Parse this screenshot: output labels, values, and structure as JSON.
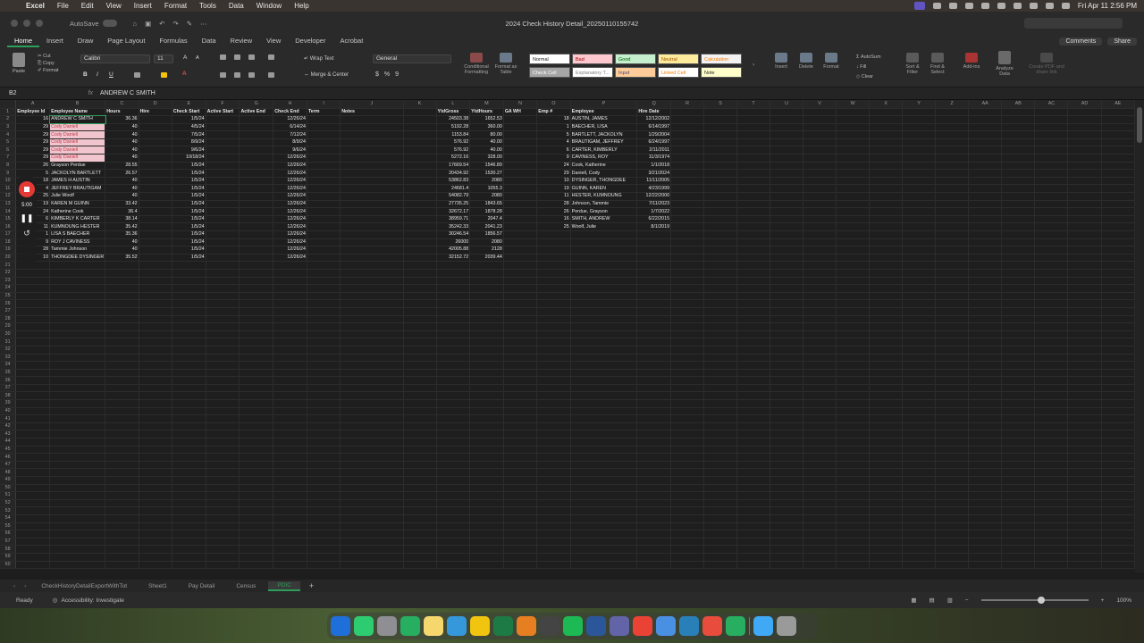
{
  "menubar": {
    "app": "Excel",
    "menus": [
      "File",
      "Edit",
      "View",
      "Insert",
      "Format",
      "Tools",
      "Data",
      "Window",
      "Help"
    ],
    "clock": "Fri Apr 11  2:56 PM"
  },
  "titlebar": {
    "autosave": "AutoSave",
    "doc_title": "2024 Check History Detail_20250110155742"
  },
  "ribbon_tabs": [
    "Home",
    "Insert",
    "Draw",
    "Page Layout",
    "Formulas",
    "Data",
    "Review",
    "View",
    "Developer",
    "Acrobat"
  ],
  "ribbon_buttons": {
    "comments": "Comments",
    "share": "Share"
  },
  "ribbon": {
    "paste": "Paste",
    "cut": "Cut",
    "copy": "Copy",
    "format": "Format",
    "font_name": "Calibri",
    "font_size": "11",
    "wrap_text": "Wrap Text",
    "merge_center": "Merge & Center",
    "number_format": "General",
    "cond_format": "Conditional Formatting",
    "format_table": "Format as Table",
    "styles": [
      {
        "label": "Normal",
        "bg": "#ffffff",
        "fg": "#222222"
      },
      {
        "label": "Bad",
        "bg": "#ffc7ce",
        "fg": "#9c0006"
      },
      {
        "label": "Good",
        "bg": "#c6efce",
        "fg": "#006100"
      },
      {
        "label": "Neutral",
        "bg": "#ffeb9c",
        "fg": "#9c5700"
      },
      {
        "label": "Calculation",
        "bg": "#f2f2f2",
        "fg": "#fa7d00"
      },
      {
        "label": "Check Cell",
        "bg": "#a5a5a5",
        "fg": "#ffffff"
      },
      {
        "label": "Explanatory T...",
        "bg": "#ffffff",
        "fg": "#7f7f7f"
      },
      {
        "label": "Input",
        "bg": "#ffcc99",
        "fg": "#3f3f76"
      },
      {
        "label": "Linked Cell",
        "bg": "#ffffff",
        "fg": "#fa7d00"
      },
      {
        "label": "Note",
        "bg": "#ffffcc",
        "fg": "#222222"
      }
    ],
    "insert": "Insert",
    "delete": "Delete",
    "format_cells": "Format",
    "autosum": "AutoSum",
    "fill": "Fill",
    "clear": "Clear",
    "sort_filter": "Sort & Filter",
    "find_select": "Find & Select",
    "addins": "Add-ins",
    "analyze": "Analyze Data",
    "create_pdf": "Create PDF and share link"
  },
  "formula_bar": {
    "cell_ref": "B2",
    "fx": "fx",
    "content": "ANDREW C SMITH"
  },
  "grid": {
    "columns": [
      "A",
      "B",
      "C",
      "D",
      "E",
      "F",
      "G",
      "H",
      "I",
      "J",
      "K",
      "L",
      "M",
      "N",
      "O",
      "P",
      "Q",
      "R",
      "S",
      "T",
      "U",
      "V",
      "W",
      "X",
      "Y",
      "Z",
      "AA",
      "AB",
      "AC",
      "AD",
      "AE"
    ],
    "rows": [
      [
        "Employee Id",
        "Employee Name",
        "Hours",
        "Hire",
        "Check Start",
        "Active Start",
        "Active End",
        "Check End",
        "Term",
        "Notes",
        "",
        "YtdGross",
        "YtdHours",
        "GA WH",
        "Emp #",
        "Employee",
        "Hire Date"
      ],
      [
        "16",
        "ANDREW C SMITH",
        "36.36",
        "",
        "1/5/24",
        "",
        "",
        "12/26/24",
        "",
        "",
        "",
        "24503.38",
        "1652.53",
        "",
        "18",
        "AUSTIN, JAMES",
        "12/12/2002"
      ],
      [
        "29",
        "Cody Daniell",
        "40",
        "",
        "4/5/24",
        "",
        "",
        "6/14/24",
        "",
        "",
        "",
        "5192.28",
        "360.00",
        "",
        "1",
        "BAECHER, LISA",
        "6/14/1997"
      ],
      [
        "29",
        "Cody Daniell",
        "40",
        "",
        "7/5/24",
        "",
        "",
        "7/12/24",
        "",
        "",
        "",
        "1153.84",
        "80.00",
        "",
        "5",
        "BARTLETT, JACKOLYN",
        "1/29/2004"
      ],
      [
        "29",
        "Cody Daniell",
        "40",
        "",
        "8/9/24",
        "",
        "",
        "8/9/24",
        "",
        "",
        "",
        "576.92",
        "40.00",
        "",
        "4",
        "BRAUTIGAM, JEFFREY",
        "6/24/1997"
      ],
      [
        "29",
        "Cody Daniell",
        "40",
        "",
        "9/6/24",
        "",
        "",
        "9/6/24",
        "",
        "",
        "",
        "576.92",
        "40.00",
        "",
        "6",
        "CARTER, KIMBERLY",
        "2/11/2011"
      ],
      [
        "29",
        "Cody Daniell",
        "40",
        "",
        "10/18/24",
        "",
        "",
        "12/26/24",
        "",
        "",
        "",
        "5272.16",
        "328.00",
        "",
        "9",
        "CAVINESS, ROY",
        "11/3/1974"
      ],
      [
        "26",
        "Grayson Perdue",
        "28.55",
        "",
        "1/5/24",
        "",
        "",
        "12/26/24",
        "",
        "",
        "",
        "17669.54",
        "1546.89",
        "",
        "24",
        "Cook, Katherine",
        "1/1/2018"
      ],
      [
        "5",
        "JACKOLYN BARTLETT",
        "26.57",
        "",
        "1/5/24",
        "",
        "",
        "12/26/24",
        "",
        "",
        "",
        "20434.92",
        "1530.27",
        "",
        "29",
        "Daniell, Cody",
        "3/21/2024"
      ],
      [
        "18",
        "JAMES H AUSTIN",
        "40",
        "",
        "1/5/24",
        "",
        "",
        "12/26/24",
        "",
        "",
        "",
        "53862.83",
        "2080",
        "",
        "10",
        "DYSINGER, THONGDEE",
        "11/11/2005"
      ],
      [
        "4",
        "JEFFREY BRAUTIGAM",
        "40",
        "",
        "1/5/24",
        "",
        "",
        "12/26/24",
        "",
        "",
        "",
        "24681.4",
        "1055.3",
        "",
        "19",
        "GUINN, KAREN",
        "4/23/1999"
      ],
      [
        "25",
        "Julie Woolf",
        "40",
        "",
        "1/5/24",
        "",
        "",
        "12/26/24",
        "",
        "",
        "",
        "54082.79",
        "2080",
        "",
        "11",
        "HESTER, KUMNOUNG",
        "12/22/2000"
      ],
      [
        "19",
        "KAREN M GUINN",
        "33.42",
        "",
        "1/5/24",
        "",
        "",
        "12/26/24",
        "",
        "",
        "",
        "27735.25",
        "1843.65",
        "",
        "28",
        "Johnson, Tammie",
        "7/11/2023"
      ],
      [
        "24",
        "Katherine Cook",
        "36.4",
        "",
        "1/5/24",
        "",
        "",
        "12/26/24",
        "",
        "",
        "",
        "32672.17",
        "1878.28",
        "",
        "26",
        "Perdue, Grayson",
        "1/7/2022"
      ],
      [
        "6",
        "KIMBERLY K CARTER",
        "38.14",
        "",
        "1/5/24",
        "",
        "",
        "12/26/24",
        "",
        "",
        "",
        "38959.71",
        "2047.4",
        "",
        "16",
        "SMITH, ANDREW",
        "6/22/2015"
      ],
      [
        "11",
        "KUMNOUNG HESTER",
        "35.42",
        "",
        "1/5/24",
        "",
        "",
        "12/26/24",
        "",
        "",
        "",
        "35242.33",
        "2041.23",
        "",
        "25",
        "Woolf, Julie",
        "8/1/2019"
      ],
      [
        "1",
        "LISA S BAECHER",
        "35.36",
        "",
        "1/5/24",
        "",
        "",
        "12/26/24",
        "",
        "",
        "",
        "30246.54",
        "1856.57",
        "",
        "",
        "",
        ""
      ],
      [
        "9",
        "ROY J CAVINESS",
        "40",
        "",
        "1/5/24",
        "",
        "",
        "12/26/24",
        "",
        "",
        "",
        "26000",
        "2080",
        "",
        "",
        "",
        ""
      ],
      [
        "28",
        "Tammie Johnson",
        "40",
        "",
        "1/5/24",
        "",
        "",
        "12/26/24",
        "",
        "",
        "",
        "42005.88",
        "2128",
        "",
        "",
        "",
        ""
      ],
      [
        "10",
        "THONGDEE DYSINGER",
        "35.52",
        "",
        "1/5/24",
        "",
        "",
        "12/26/24",
        "",
        "",
        "",
        "32152.72",
        "2039.44",
        "",
        "",
        "",
        ""
      ]
    ],
    "total_rows": 60
  },
  "recorder": {
    "time": "5:00"
  },
  "sheet_tabs": [
    "CheckHistoryDetailExportWithTot",
    "Sheet1",
    "Pay Detail",
    "Census",
    "PDIC"
  ],
  "active_sheet": "PDIC",
  "status": {
    "ready": "Ready",
    "accessibility": "Accessibility: Investigate",
    "zoom": "100%"
  }
}
